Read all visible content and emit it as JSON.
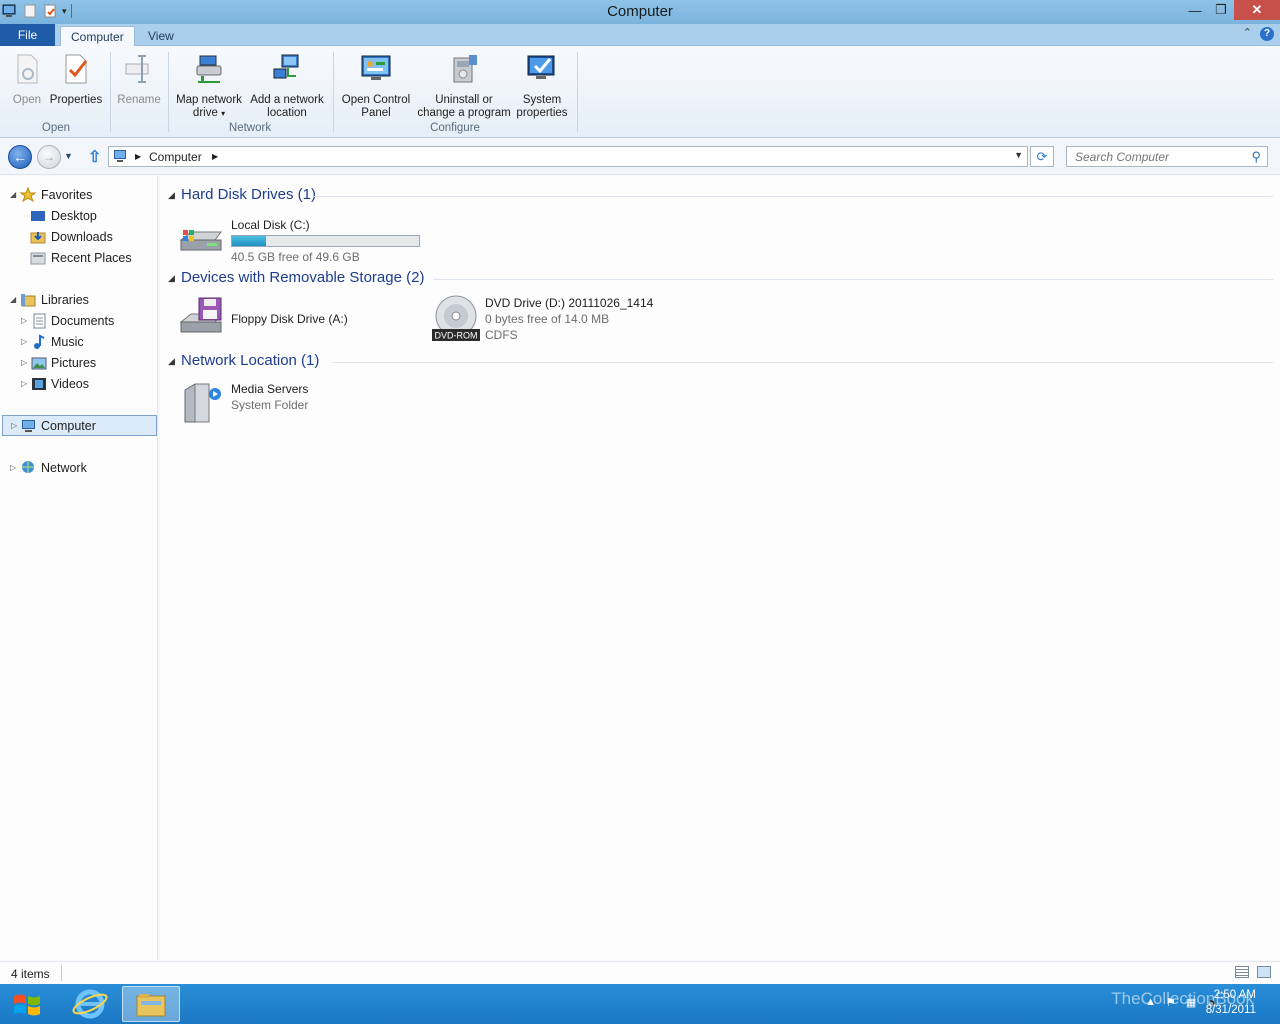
{
  "window": {
    "title": "Computer"
  },
  "tabs": {
    "file": "File",
    "computer": "Computer",
    "view": "View"
  },
  "ribbon": {
    "open": "Open",
    "properties": "Properties",
    "rename": "Rename",
    "map_network_drive_l1": "Map network",
    "map_network_drive_l2": "drive",
    "add_network_location_l1": "Add a network",
    "add_network_location_l2": "location",
    "open_control_panel_l1": "Open Control",
    "open_control_panel_l2": "Panel",
    "uninstall_l1": "Uninstall or",
    "uninstall_l2": "change a program",
    "system_properties_l1": "System",
    "system_properties_l2": "properties",
    "groups": {
      "open": "Open",
      "network": "Network",
      "configure": "Configure"
    }
  },
  "address": {
    "crumb": "Computer",
    "search_placeholder": "Search Computer"
  },
  "nav": {
    "favorites": "Favorites",
    "desktop": "Desktop",
    "downloads": "Downloads",
    "recent_places": "Recent Places",
    "libraries": "Libraries",
    "documents": "Documents",
    "music": "Music",
    "pictures": "Pictures",
    "videos": "Videos",
    "computer": "Computer",
    "network": "Network"
  },
  "content": {
    "hdd_group": "Hard Disk Drives (1)",
    "local_disk": {
      "name": "Local Disk (C:)",
      "free": "40.5 GB free of 49.6 GB",
      "used_fraction": 0.18
    },
    "removable_group": "Devices with Removable Storage (2)",
    "floppy": {
      "name": "Floppy Disk Drive (A:)"
    },
    "dvd": {
      "name": "DVD Drive (D:) 20111026_1414",
      "free": "0 bytes free of 14.0 MB",
      "fs": "CDFS",
      "badge": "DVD-ROM"
    },
    "network_group": "Network Location (1)",
    "media": {
      "name": "Media Servers",
      "type": "System Folder"
    }
  },
  "status": {
    "count": "4 items"
  },
  "taskbar": {
    "time": "2:50 AM",
    "date": "8/31/2011",
    "watermark": "TheCollectionBook"
  },
  "colors": {
    "accent": "#1f5ba6",
    "titlebar": "#7ab4de",
    "taskbar": "#1a77c4",
    "group_heading": "#1e3d8f"
  }
}
